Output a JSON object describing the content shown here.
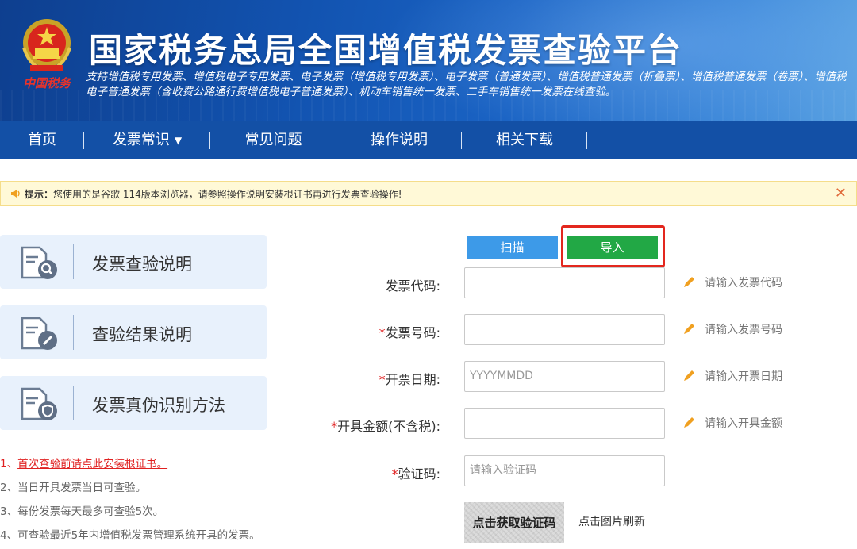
{
  "header": {
    "title": "国家税务总局全国增值税发票查验平台",
    "subtitle": "支持增值税专用发票、增值税电子专用发票、电子发票（增值税专用发票）、电子发票（普通发票）、增值税普通发票（折叠票）、增值税普通发票（卷票）、增值税电子普通发票（含收费公路通行费增值税电子普通发票）、机动车销售统一发票、二手车销售统一发票在线查验。",
    "seal_text": "中国税务"
  },
  "nav": {
    "items": [
      {
        "label": "首页"
      },
      {
        "label": "发票常识"
      },
      {
        "label": "常见问题"
      },
      {
        "label": "操作说明"
      },
      {
        "label": "相关下载"
      }
    ]
  },
  "notice": {
    "bold": "提示：",
    "text": "您使用的是谷歌 114版本浏览器，请参照操作说明安装根证书再进行发票查验操作!"
  },
  "cards": [
    {
      "title": "发票查验说明",
      "icon": "document-search-icon"
    },
    {
      "title": "查验结果说明",
      "icon": "document-edit-icon"
    },
    {
      "title": "发票真伪识别方法",
      "icon": "document-shield-icon"
    }
  ],
  "tips": {
    "t1_prefix": "1、",
    "t1_link": "首次查验前请点此安装根证书。",
    "t2": "2、当日开具发票当日可查验。",
    "t3": "3、每份发票每天最多可查验5次。",
    "t4": "4、可查验最近5年内增值税发票管理系统开具的发票。"
  },
  "form": {
    "scan_label": "扫描",
    "import_label": "导入",
    "code_label": "发票代码:",
    "number_label": "发票号码:",
    "date_label": "开票日期:",
    "amount_label": "开具金额(不含税):",
    "captcha_label": "验证码:",
    "required_mark": "*",
    "date_placeholder": "YYYYMMDD",
    "captcha_placeholder": "请输入验证码",
    "code_hint": "请输入发票代码",
    "number_hint": "请输入发票号码",
    "date_hint": "请输入开票日期",
    "amount_hint": "请输入开具金额",
    "captcha_image_text": "点击获取验证码",
    "captcha_refresh": "点击图片刷新"
  },
  "colors": {
    "nav_bg": "#1350a6",
    "scan_button": "#3d9ae8",
    "import_button": "#22a845",
    "highlight_border": "#e3271e",
    "required": "#e02020"
  }
}
